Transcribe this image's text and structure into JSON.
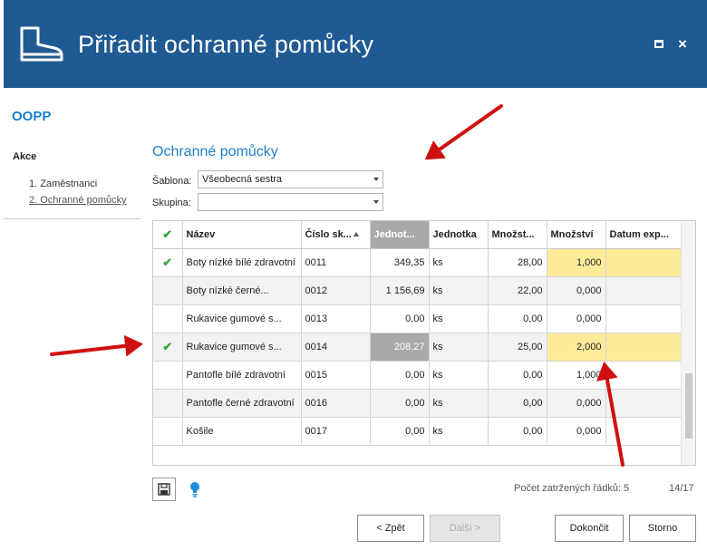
{
  "window": {
    "title": "Přiřadit ochranné pomůcky",
    "icon": "boot-icon",
    "title_color": "#1f5a93"
  },
  "app_name": "OOPP",
  "sidebar": {
    "heading": "Akce",
    "steps": [
      "1. Zaměstnanci",
      "2. Ochranné pomůcky"
    ],
    "active_step": 1
  },
  "section": {
    "title": "Ochranné pomůcky",
    "sablona_label": "Šablona:",
    "sablona_value": "Všeobecná sestra",
    "skupina_label": "Skupina:",
    "skupina_value": ""
  },
  "grid": {
    "columns": [
      "",
      "Název",
      "Číslo sk...",
      "Jednot...",
      "Jednotka",
      "Množst...",
      "Množství",
      "Datum exp..."
    ],
    "sort_column": "Číslo sk...",
    "rows": [
      {
        "checked": true,
        "name": "Boty nízké bílé zdravotní",
        "code": "0011",
        "price": "349,35",
        "unit": "ks",
        "stock": "28,00",
        "qty": "1,000",
        "expiry": "",
        "highlight": true,
        "marked": false
      },
      {
        "checked": false,
        "name": "Boty nízké černé...",
        "code": "0012",
        "price": "1 156,69",
        "unit": "ks",
        "stock": "22,00",
        "qty": "0,000",
        "expiry": "",
        "highlight": false,
        "marked": false
      },
      {
        "checked": false,
        "name": "Rukavice gumové s...",
        "code": "0013",
        "price": "0,00",
        "unit": "ks",
        "stock": "0,00",
        "qty": "0,000",
        "expiry": "",
        "highlight": false,
        "marked": false
      },
      {
        "checked": true,
        "name": "Rukavice gumové s...",
        "code": "0014",
        "price": "208,27",
        "unit": "ks",
        "stock": "25,00",
        "qty": "2,000",
        "expiry": "",
        "highlight": true,
        "marked": true
      },
      {
        "checked": false,
        "name": "Pantofle bílé zdravotní",
        "code": "0015",
        "price": "0,00",
        "unit": "ks",
        "stock": "0,00",
        "qty": "1,000",
        "expiry": "",
        "highlight": false,
        "marked": false
      },
      {
        "checked": false,
        "name": "Pantofle černé zdravotní",
        "code": "0016",
        "price": "0,00",
        "unit": "ks",
        "stock": "0,00",
        "qty": "0,000",
        "expiry": "",
        "highlight": false,
        "marked": false
      },
      {
        "checked": false,
        "name": "Košile",
        "code": "0017",
        "price": "0,00",
        "unit": "ks",
        "stock": "0,00",
        "qty": "0,000",
        "expiry": "",
        "highlight": false,
        "marked": false
      }
    ]
  },
  "footer": {
    "save_icon": "save-icon",
    "hint_icon": "lightbulb-icon",
    "count_text": "Počet zatržených řádků: 5",
    "pager_text": "14/17"
  },
  "buttons": {
    "back": "< Zpět",
    "next": "Další >",
    "finish": "Dokončit",
    "cancel": "Storno"
  },
  "colors": {
    "accent": "#1a7fc9",
    "highlight": "#fdeb9a",
    "check": "#3aa835",
    "annotation_arrow": "#d01010"
  }
}
